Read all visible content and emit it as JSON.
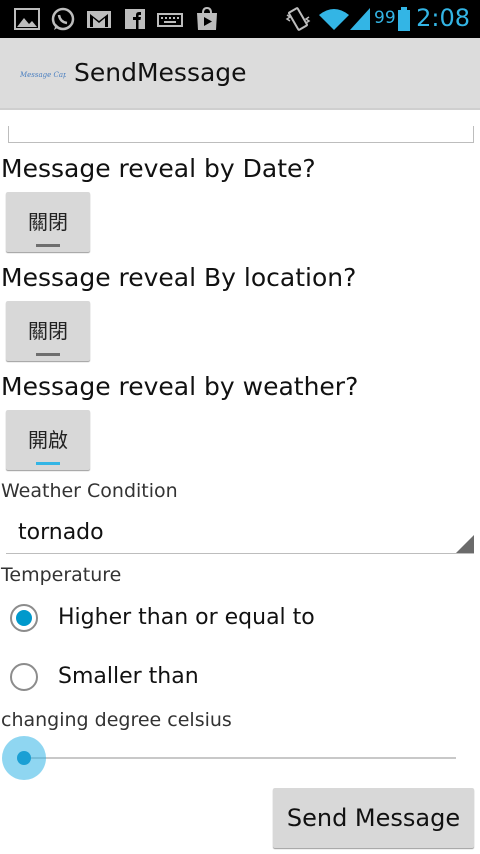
{
  "status_bar": {
    "icons": [
      "gallery-icon",
      "whatsapp-icon",
      "gmail-icon",
      "facebook-icon",
      "keyboard-icon",
      "play-store-icon",
      "vibrate-icon",
      "wifi-icon",
      "signal-icon",
      "battery-icon"
    ],
    "battery": "99",
    "time": "2:08"
  },
  "action_bar": {
    "title": "SendMessage",
    "logo_text": "Message Capsule"
  },
  "reveal_date": {
    "question": "Message reveal by Date?",
    "toggle_label": "關閉",
    "on": false
  },
  "reveal_location": {
    "question": "Message reveal By location?",
    "toggle_label": "關閉",
    "on": false
  },
  "reveal_weather": {
    "question": "Message reveal by weather?",
    "toggle_label": "開啟",
    "on": true
  },
  "weather": {
    "label": "Weather Condition",
    "selected": "tornado"
  },
  "temperature": {
    "label": "Temperature",
    "options": [
      {
        "label": "Higher than or equal to",
        "checked": true
      },
      {
        "label": "Smaller than",
        "checked": false
      }
    ]
  },
  "degree": {
    "label": "changing degree celsius",
    "value_fraction": 0.0
  },
  "send_button": "Send Message",
  "colors": {
    "accent": "#33b5e5",
    "status_bar": "#000000",
    "action_bar": "#dcdcdc"
  }
}
